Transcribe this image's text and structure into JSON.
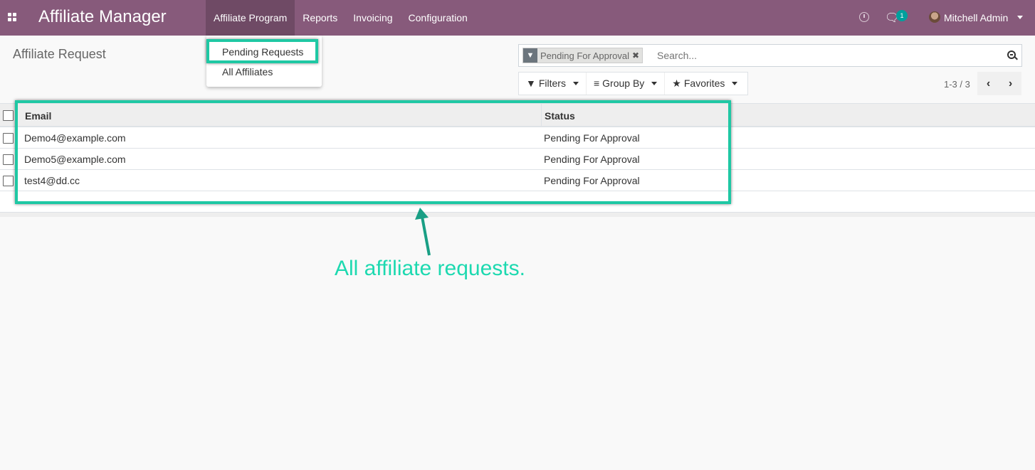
{
  "navbar": {
    "app_title": "Affiliate Manager",
    "menu": [
      "Affiliate Program",
      "Reports",
      "Invoicing",
      "Configuration"
    ],
    "active_menu": "Affiliate Program",
    "chat_count": "1",
    "user_name": "Mitchell Admin"
  },
  "dropdown": {
    "items": [
      "Pending Requests",
      "All Affiliates"
    ]
  },
  "control_panel": {
    "breadcrumb": "Affiliate Request",
    "facet_label": "Pending For Approval",
    "search_placeholder": "Search...",
    "filters_label": "Filters",
    "group_by_label": "Group By",
    "favorites_label": "Favorites",
    "pager": "1-3 / 3"
  },
  "list": {
    "columns": [
      "Email",
      "Status"
    ],
    "rows": [
      {
        "email": "Demo4@example.com",
        "status": "Pending For Approval"
      },
      {
        "email": "Demo5@example.com",
        "status": "Pending For Approval"
      },
      {
        "email": "test4@dd.cc",
        "status": "Pending For Approval"
      }
    ]
  },
  "annotation": {
    "text": "All affiliate requests.",
    "color": "#1dd9b0"
  },
  "colors": {
    "navbar": "#875a7b",
    "highlight": "#1fc8a4"
  }
}
